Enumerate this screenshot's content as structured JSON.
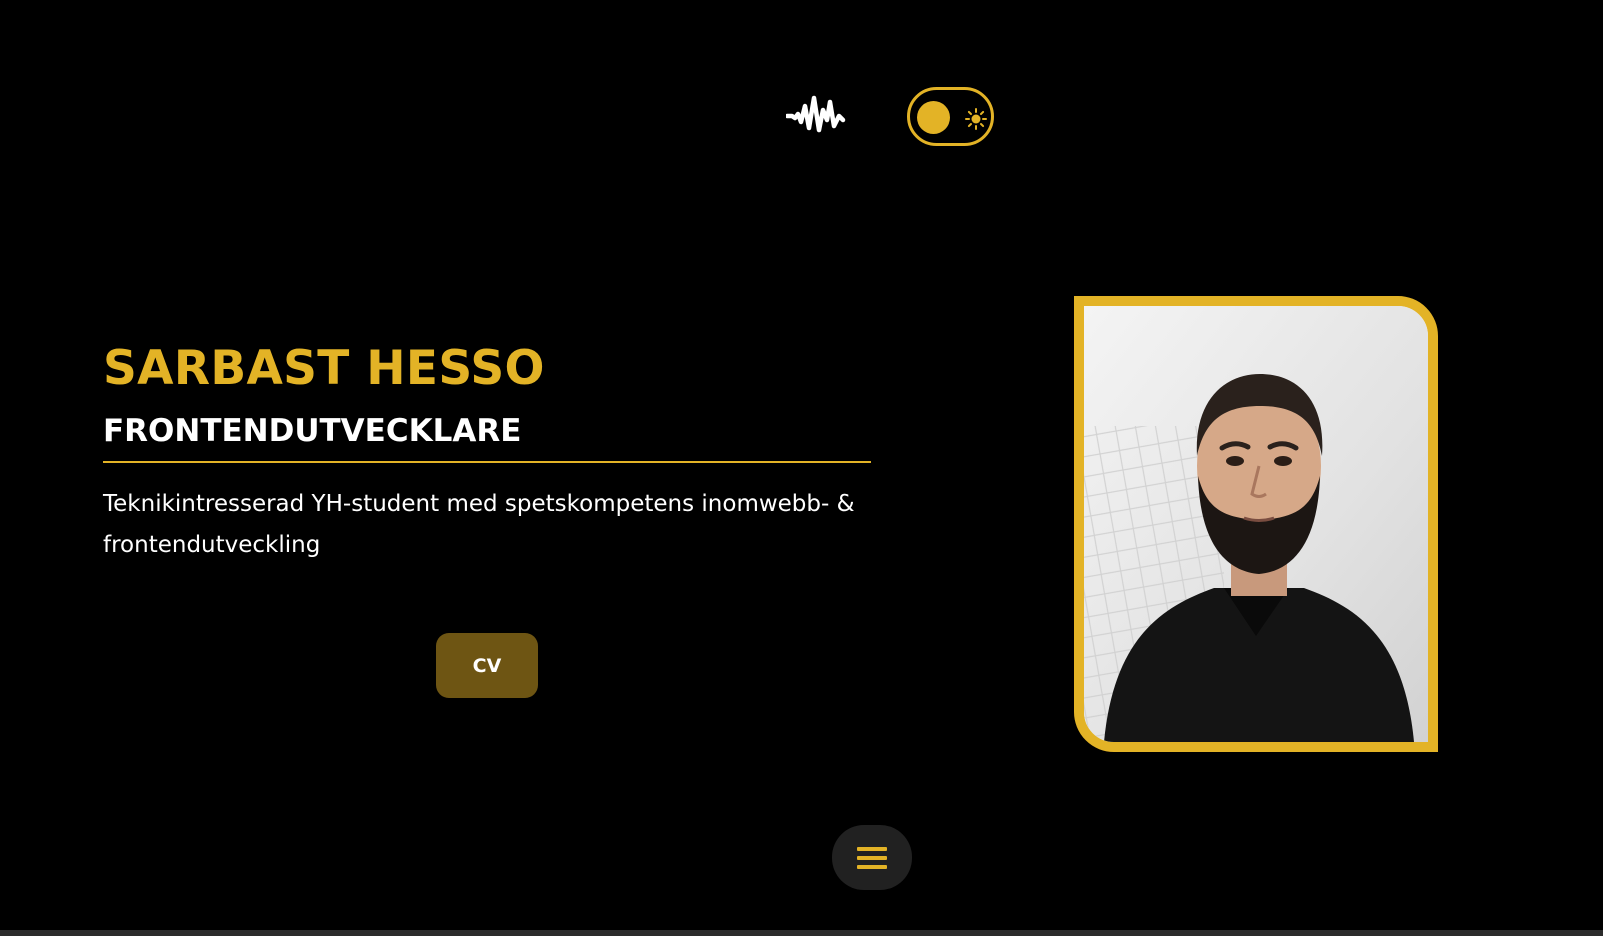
{
  "theme": {
    "accent": "#e3b326",
    "background": "#000000",
    "button_bg": "#6e5513",
    "menu_bg": "#212121"
  },
  "header": {
    "logo_icon": "audiomack-waveform-icon",
    "theme_toggle": {
      "knob_icon": "circle-knob",
      "mode_icon": "sun-icon",
      "state": "dark"
    }
  },
  "hero": {
    "name": "SARBAST HESSO",
    "role": "FRONTENDUTVECKLARE",
    "tagline": "Teknikintresserad YH-student med spetskompetens inomwebb- & frontendutveckling",
    "cv_label": "CV",
    "photo_alt": "Portrait photo"
  },
  "nav": {
    "menu_icon": "hamburger-menu-icon"
  }
}
